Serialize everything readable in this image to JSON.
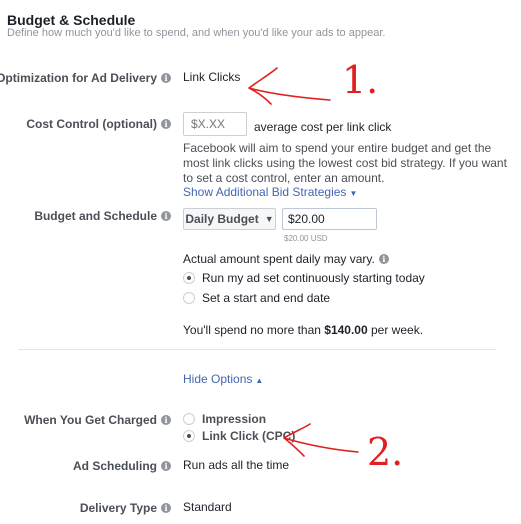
{
  "header": {
    "title": "Budget & Schedule",
    "subtitle": "Define how much you'd like to spend, and when you'd like your ads to appear."
  },
  "optimization": {
    "label": "Optimization for Ad Delivery",
    "value": "Link Clicks"
  },
  "cost_control": {
    "label": "Cost Control (optional)",
    "placeholder": "$X.XX",
    "suffix": "average cost per link click",
    "description": "Facebook will aim to spend your entire budget and get the most link clicks using the lowest cost bid strategy. If you want to set a cost control, enter an amount.",
    "link": "Show Additional Bid Strategies"
  },
  "budget": {
    "label": "Budget and Schedule",
    "dropdown_label": "Daily Budget",
    "amount": "$20.00",
    "amount_note": "$20.00 USD",
    "actual_note": "Actual amount spent daily may vary.",
    "options": [
      {
        "label": "Run my ad set continuously starting today",
        "selected": true
      },
      {
        "label": "Set a start and end date",
        "selected": false
      }
    ],
    "spend_prefix": "You'll spend no more than ",
    "spend_amount": "$140.00",
    "spend_suffix": " per week."
  },
  "hide_options": "Hide Options",
  "charged": {
    "label": "When You Get Charged",
    "options": [
      {
        "label": "Impression",
        "selected": false
      },
      {
        "label": "Link Click (CPC)",
        "selected": true
      }
    ]
  },
  "ad_scheduling": {
    "label": "Ad Scheduling",
    "value": "Run ads all the time"
  },
  "delivery_type": {
    "label": "Delivery Type",
    "value": "Standard"
  },
  "annotations": {
    "one": "1.",
    "two": "2.",
    "color": "#e02020"
  },
  "colors": {
    "link": "#4267b2",
    "label": "#4b4f56",
    "muted": "#90949c"
  }
}
